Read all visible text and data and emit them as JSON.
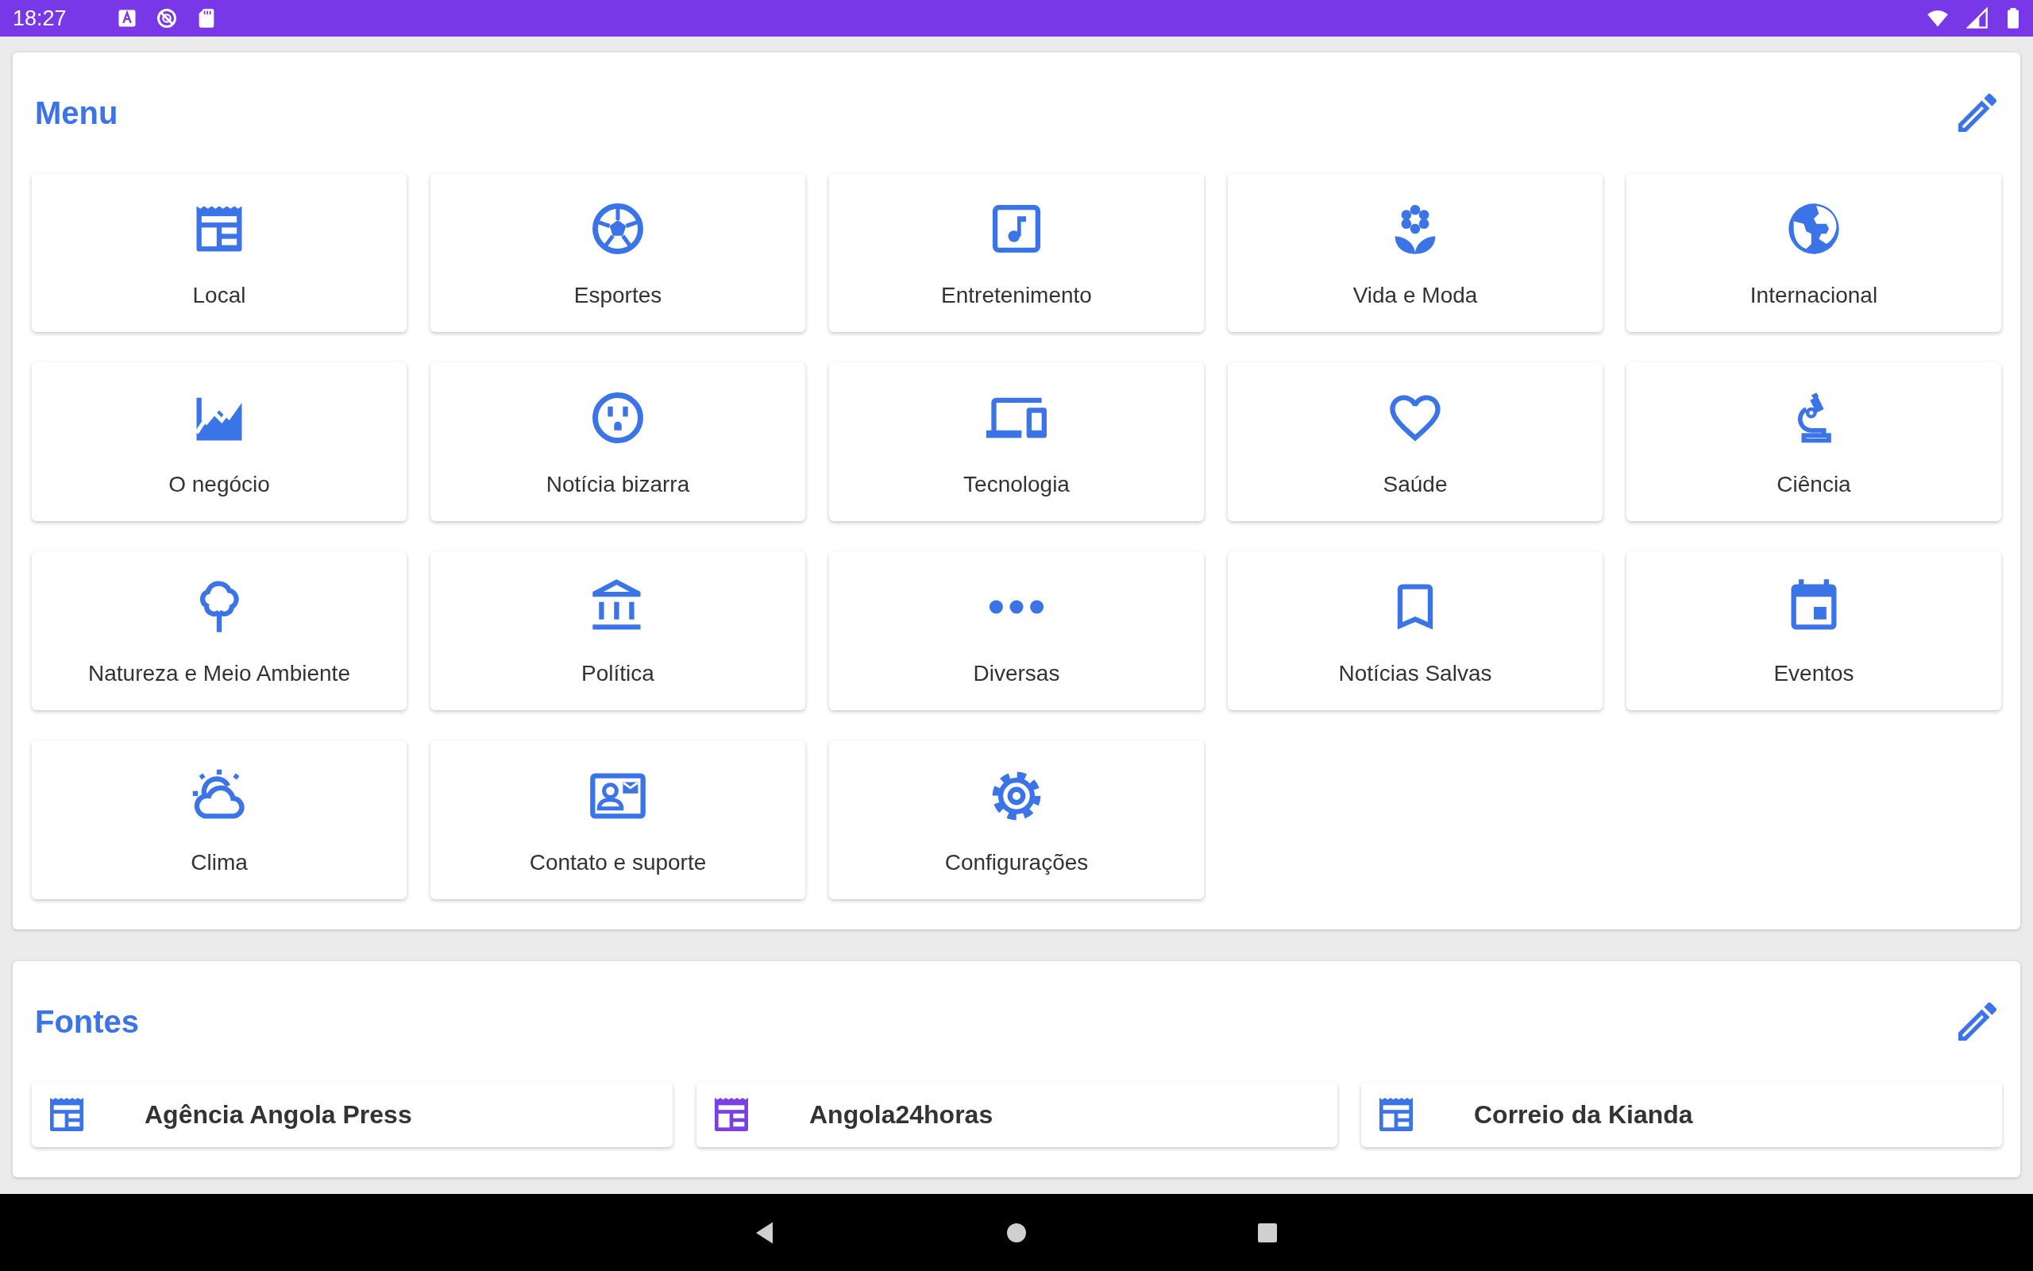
{
  "status_bar": {
    "time": "18:27"
  },
  "menu": {
    "title": "Menu",
    "tiles": [
      {
        "label": "Local",
        "kind": "newspaper"
      },
      {
        "label": "Esportes",
        "kind": "ball"
      },
      {
        "label": "Entretenimento",
        "kind": "music"
      },
      {
        "label": "Vida e Moda",
        "kind": "flower"
      },
      {
        "label": "Internacional",
        "kind": "globe"
      },
      {
        "label": "O negócio",
        "kind": "chart"
      },
      {
        "label": "Notícia bizarra",
        "kind": "face"
      },
      {
        "label": "Tecnologia",
        "kind": "devices"
      },
      {
        "label": "Saúde",
        "kind": "heart"
      },
      {
        "label": "Ciência",
        "kind": "microscope"
      },
      {
        "label": "Natureza e Meio Ambiente",
        "kind": "tree"
      },
      {
        "label": "Política",
        "kind": "bank"
      },
      {
        "label": "Diversas",
        "kind": "dots"
      },
      {
        "label": "Notícias Salvas",
        "kind": "bookmark"
      },
      {
        "label": "Eventos",
        "kind": "calendar"
      },
      {
        "label": "Clima",
        "kind": "weather"
      },
      {
        "label": "Contato e suporte",
        "kind": "contact"
      },
      {
        "label": "Configurações",
        "kind": "gear"
      }
    ]
  },
  "sources": {
    "title": "Fontes",
    "items": [
      {
        "name": "Agência Angola Press",
        "color": "#3b74e6"
      },
      {
        "name": "Angola24horas",
        "color": "#7b3fe4"
      },
      {
        "name": "Correio da Kianda",
        "color": "#3b74e6"
      }
    ]
  }
}
